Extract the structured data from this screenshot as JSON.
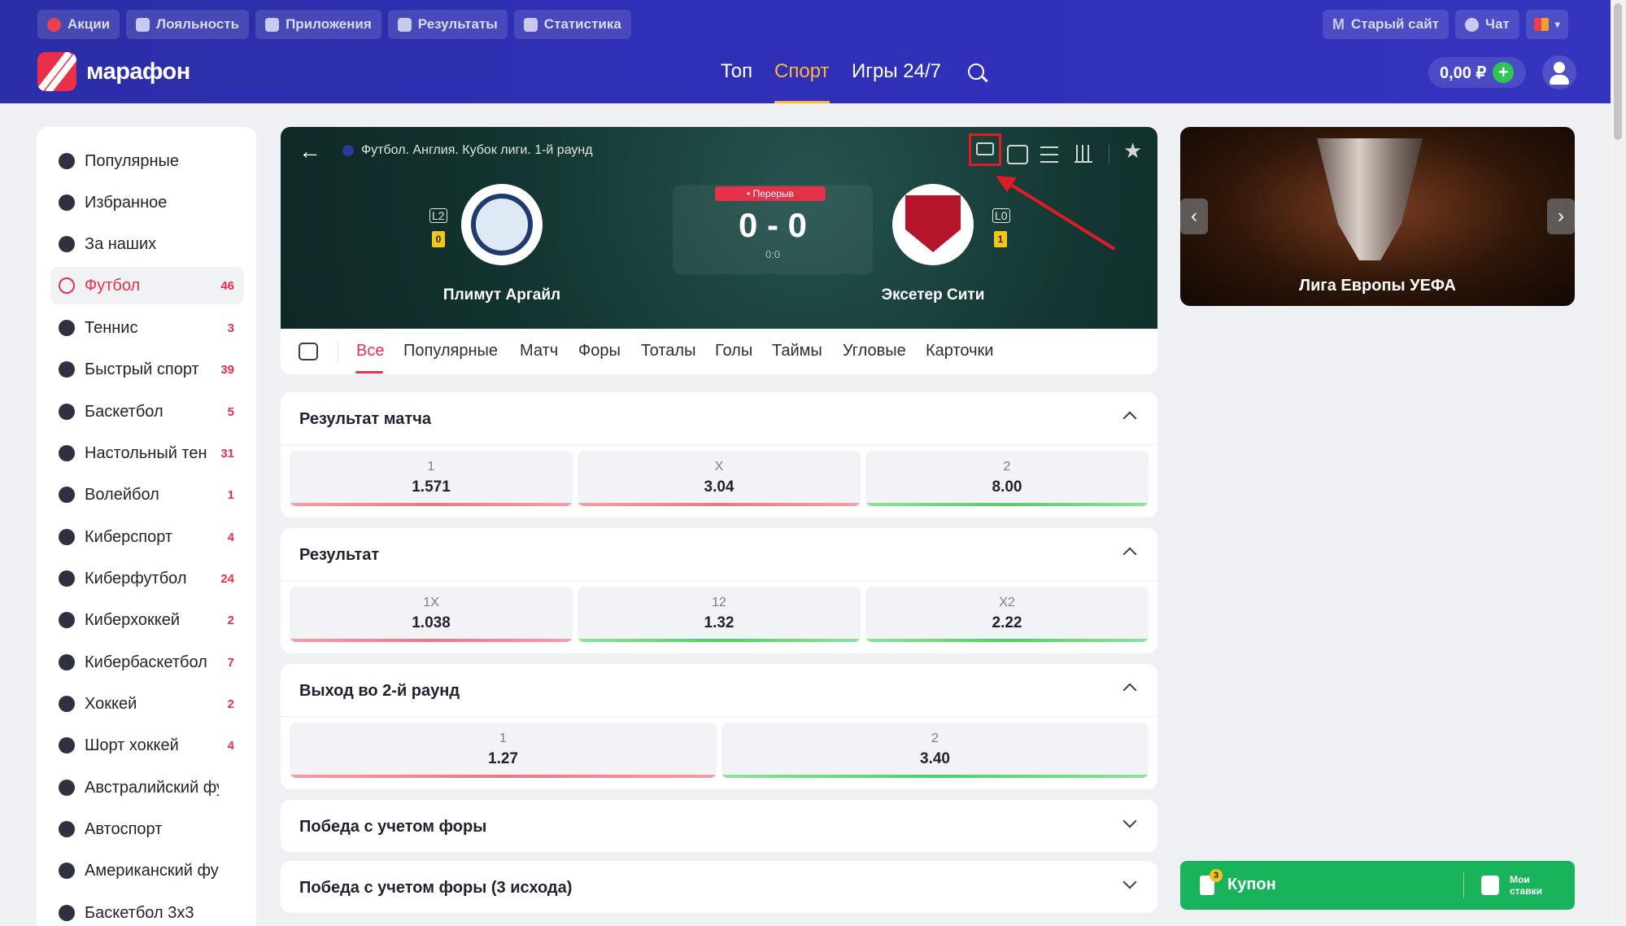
{
  "header": {
    "top_links": [
      {
        "label": "Акции",
        "icon": "flame-icon"
      },
      {
        "label": "Лояльность",
        "icon": "star-badge-icon"
      },
      {
        "label": "Приложения",
        "icon": "phone-icon"
      },
      {
        "label": "Результаты",
        "icon": "results-icon"
      },
      {
        "label": "Статистика",
        "icon": "stats-icon"
      }
    ],
    "old_site": "Старый сайт",
    "old_site_letter": "M",
    "chat": "Чат",
    "logo_text": "марафон",
    "nav": [
      "Топ",
      "Спорт",
      "Игры 24/7"
    ],
    "active_nav": "Спорт",
    "balance": "0,00 ₽",
    "plus": "+"
  },
  "sidebar": {
    "items": [
      {
        "label": "Популярные",
        "count": "",
        "icon": "flame-icon"
      },
      {
        "label": "Избранное",
        "count": "",
        "icon": "star-icon"
      },
      {
        "label": "За наших",
        "count": "",
        "icon": "trophy-icon"
      },
      {
        "label": "Футбол",
        "count": "46",
        "icon": "soccer-ball-icon",
        "active": true
      },
      {
        "label": "Теннис",
        "count": "3",
        "icon": "tennis-ball-icon"
      },
      {
        "label": "Быстрый спорт",
        "count": "39",
        "icon": "rocket-icon"
      },
      {
        "label": "Баскетбол",
        "count": "5",
        "icon": "basketball-icon"
      },
      {
        "label": "Настольный теннис",
        "count": "31",
        "icon": "ping-pong-icon"
      },
      {
        "label": "Волейбол",
        "count": "1",
        "icon": "volleyball-icon"
      },
      {
        "label": "Киберспорт",
        "count": "4",
        "icon": "gamepad-icon"
      },
      {
        "label": "Киберфутбол",
        "count": "24",
        "icon": "gamepad-icon"
      },
      {
        "label": "Киберхоккей",
        "count": "2",
        "icon": "gamepad-icon"
      },
      {
        "label": "Кибербаскетбол",
        "count": "7",
        "icon": "gamepad-icon"
      },
      {
        "label": "Хоккей",
        "count": "2",
        "icon": "hockey-stick-icon"
      },
      {
        "label": "Шорт хоккей",
        "count": "4",
        "icon": "hockey-stick-icon"
      },
      {
        "label": "Австралийский футбол",
        "count": "",
        "icon": "rugby-ball-icon"
      },
      {
        "label": "Автоспорт",
        "count": "",
        "icon": "steering-wheel-icon"
      },
      {
        "label": "Американский футбол",
        "count": "",
        "icon": "football-icon"
      },
      {
        "label": "Баскетбол 3x3",
        "count": "",
        "icon": "basketball-icon"
      }
    ]
  },
  "match": {
    "breadcrumb": "Футбол. Англия. Кубок лиги. 1-й раунд",
    "status": "• Перерыв",
    "score": "0 - 0",
    "halftime": "0:0",
    "home": {
      "name": "Плимут Аргайл",
      "league": "L2",
      "cards": "0"
    },
    "away": {
      "name": "Эксетер Сити",
      "league": "L0",
      "cards": "1"
    }
  },
  "tabs": [
    "Все",
    "Популярные",
    "Матч",
    "Форы",
    "Тоталы",
    "Голы",
    "Таймы",
    "Угловые",
    "Карточки"
  ],
  "markets": [
    {
      "title": "Результат матча",
      "expanded": true,
      "odds": [
        {
          "label": "1",
          "value": "1.571",
          "trend": "red"
        },
        {
          "label": "X",
          "value": "3.04",
          "trend": "red"
        },
        {
          "label": "2",
          "value": "8.00",
          "trend": "green"
        }
      ]
    },
    {
      "title": "Результат",
      "expanded": true,
      "odds": [
        {
          "label": "1X",
          "value": "1.038",
          "trend": "red"
        },
        {
          "label": "12",
          "value": "1.32",
          "trend": "green"
        },
        {
          "label": "X2",
          "value": "2.22",
          "trend": "green"
        }
      ]
    },
    {
      "title": "Выход во 2-й раунд",
      "expanded": true,
      "odds": [
        {
          "label": "1",
          "value": "1.27",
          "trend": "red"
        },
        {
          "label": "2",
          "value": "3.40",
          "trend": "green"
        }
      ]
    },
    {
      "title": "Победа с учетом форы",
      "expanded": false,
      "odds": []
    },
    {
      "title": "Победа с учетом форы (3 исхода)",
      "expanded": false,
      "odds": []
    }
  ],
  "banner": {
    "title": "Лига Европы УЕФА",
    "prev": "‹",
    "next": "›"
  },
  "coupon": {
    "label": "Купон",
    "count": "3",
    "my_bets": "Мои ставки"
  },
  "colors": {
    "header": "#2f2fb8",
    "accent": "#e8304a",
    "active_nav": "#ffb43a",
    "coupon": "#18b35a"
  }
}
